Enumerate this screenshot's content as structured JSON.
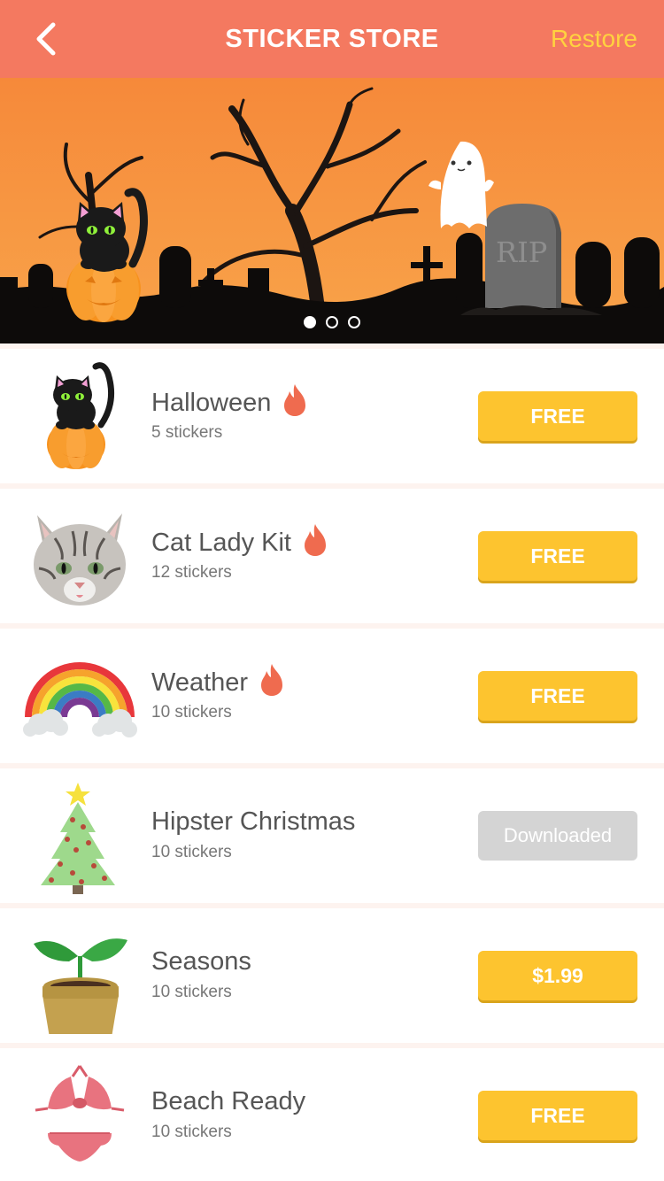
{
  "nav": {
    "title": "STICKER STORE",
    "restore_label": "Restore",
    "back_icon": "chevron-left-icon"
  },
  "banner": {
    "tombstone_text": "RIP",
    "slides": 3,
    "active_slide": 1
  },
  "colors": {
    "header": "#f47960",
    "accent_button": "#fdc42f",
    "downloaded_button": "#d4d4d4",
    "restore": "#ffd23f",
    "fire": "#ef6b4f"
  },
  "packs": [
    {
      "name": "Halloween",
      "count": "5 stickers",
      "hot": true,
      "action": "FREE",
      "state": "free",
      "icon": "cat-pumpkin-icon"
    },
    {
      "name": "Cat Lady Kit",
      "count": "12 stickers",
      "hot": true,
      "action": "FREE",
      "state": "free",
      "icon": "cat-face-icon"
    },
    {
      "name": "Weather",
      "count": "10 stickers",
      "hot": true,
      "action": "FREE",
      "state": "free",
      "icon": "rainbow-icon"
    },
    {
      "name": "Hipster Christmas",
      "count": "10 stickers",
      "hot": false,
      "action": "Downloaded",
      "state": "downloaded",
      "icon": "christmas-tree-icon"
    },
    {
      "name": "Seasons",
      "count": "10 stickers",
      "hot": false,
      "action": "$1.99",
      "state": "paid",
      "icon": "sprout-pot-icon"
    },
    {
      "name": "Beach Ready",
      "count": "10 stickers",
      "hot": false,
      "action": "FREE",
      "state": "free",
      "icon": "bikini-icon"
    }
  ]
}
